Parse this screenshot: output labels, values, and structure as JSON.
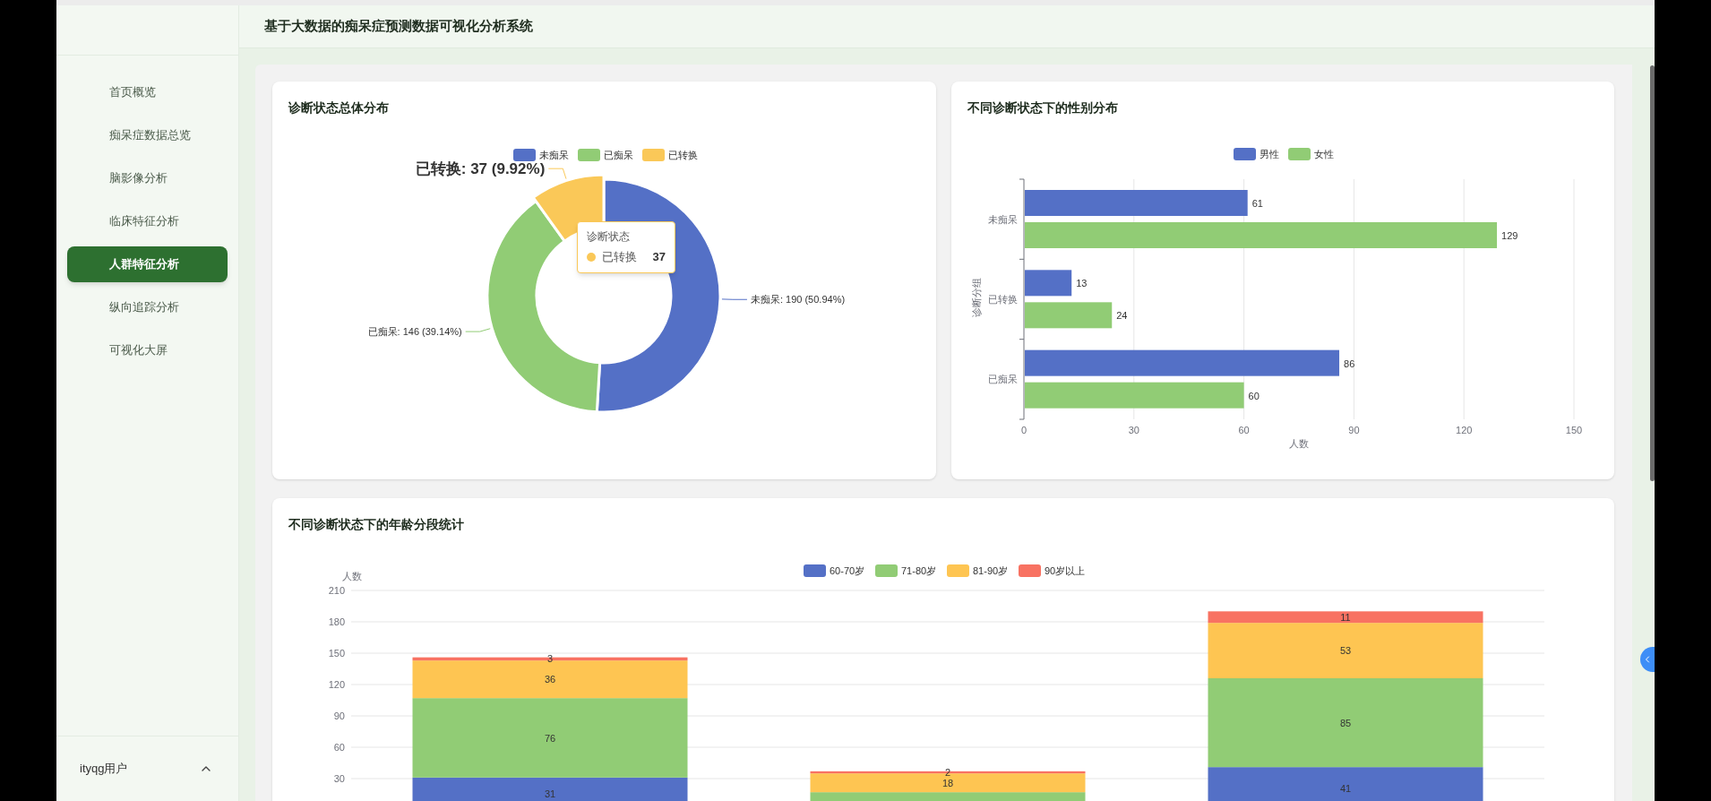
{
  "sidebar": {
    "items": [
      {
        "label": "首页概览",
        "selected": false
      },
      {
        "label": "痴呆症数据总览",
        "selected": false
      },
      {
        "label": "脑影像分析",
        "selected": false
      },
      {
        "label": "临床特征分析",
        "selected": false
      },
      {
        "label": "人群特征分析",
        "selected": true
      },
      {
        "label": "纵向追踪分析",
        "selected": false
      },
      {
        "label": "可视化大屏",
        "selected": false
      }
    ],
    "user": {
      "name": "ityqg用户"
    }
  },
  "header": {
    "title": "基于大数据的痴呆症预测数据可视化分析系统"
  },
  "cards": [
    {
      "title": "诊断状态总体分布",
      "chart_data": {
        "type": "donut",
        "legend": true,
        "categories": [
          "未痴呆",
          "已痴呆",
          "已转换"
        ],
        "values": [
          50.94,
          39.14,
          9.92
        ],
        "colors": [
          "#5470c6",
          "#91cc75",
          "#fac858"
        ]
      },
      "slices": [
        {
          "label": "未痴呆: 190 (50.94%)",
          "selected": false
        },
        {
          "label": "已痴呆: 146 (39.14%)",
          "selected": false
        },
        {
          "label": "已转换: 37 (9.92%)",
          "selected": true
        }
      ],
      "tooltip": {
        "title": "诊断状态",
        "label": "已转换",
        "value": "37",
        "color": "#fac858"
      }
    },
    {
      "title": "不同诊断状态下的性别分布",
      "chart_data": {
        "type": "bar",
        "orientation": "horizontal",
        "legend": true,
        "grid": true,
        "xlabel": "人数",
        "ylabel": "诊断分组",
        "categories": [
          "未痴呆",
          "已转换",
          "已痴呆"
        ],
        "xlim": [
          0,
          150
        ],
        "xticks": [
          0,
          30,
          60,
          90,
          120,
          150
        ],
        "data_labels": true,
        "series": [
          {
            "name": "男性",
            "color": "#5470c6",
            "values": [
              61,
              13,
              86
            ]
          },
          {
            "name": "女性",
            "color": "#91cc75",
            "values": [
              129,
              24,
              60
            ]
          }
        ]
      }
    },
    {
      "title": "不同诊断状态下的年龄分段统计",
      "chart_data": {
        "type": "bar",
        "orientation": "vertical",
        "stacked": true,
        "legend": true,
        "grid": true,
        "ylabel": "人数",
        "ylim": [
          0,
          210
        ],
        "yticks": [
          30,
          60,
          90,
          120,
          150,
          180,
          210
        ],
        "data_labels": true,
        "series": [
          {
            "name": "60-70岁",
            "color": "#5470c6",
            "values": [
              31,
              null,
              41
            ],
            "value_labels": [
              "31",
              null,
              "41"
            ]
          },
          {
            "name": "71-80岁",
            "color": "#91cc75",
            "values": [
              76,
              17,
              85
            ],
            "value_labels": [
              "76",
              null,
              "85"
            ]
          },
          {
            "name": "81-90岁",
            "color": "#fec552",
            "values": [
              36,
              18,
              53
            ],
            "value_labels": [
              "36",
              "18",
              "53"
            ]
          },
          {
            "name": "90岁以上",
            "color": "#f87262",
            "values": [
              3,
              2,
              11
            ],
            "value_labels": [
              "3",
              "2",
              "11"
            ]
          }
        ]
      }
    }
  ]
}
